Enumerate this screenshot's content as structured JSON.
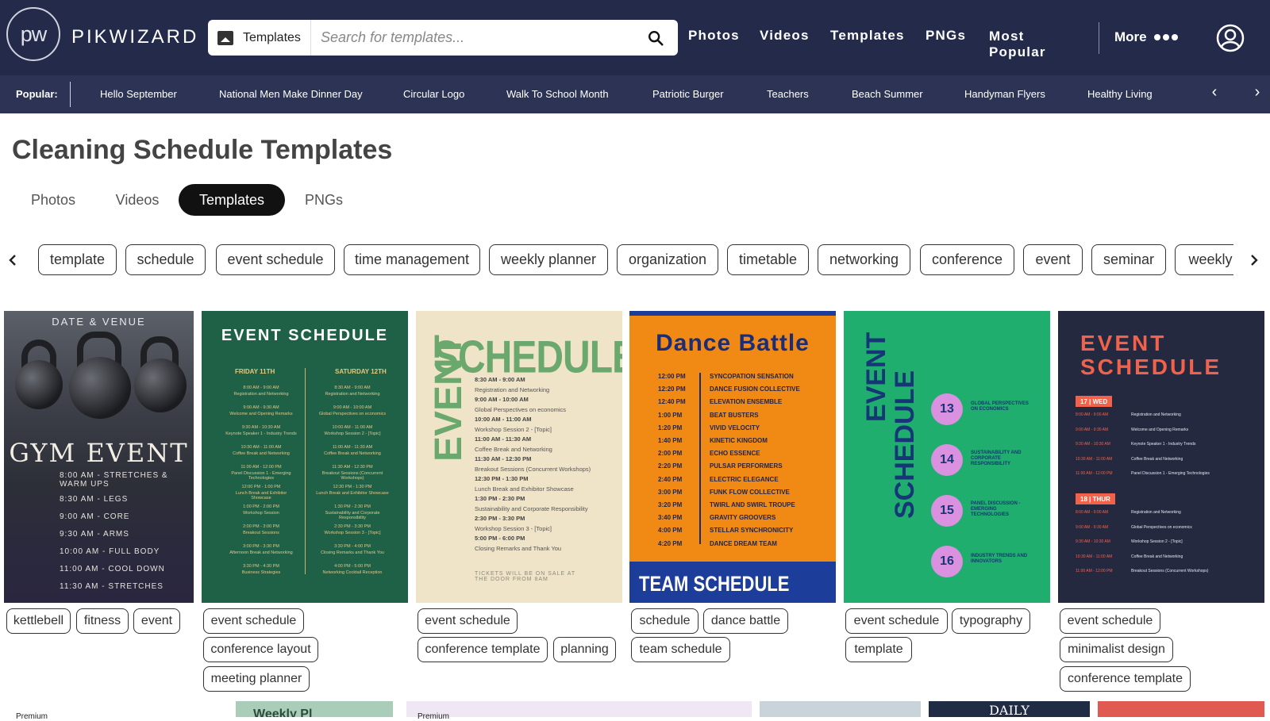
{
  "header": {
    "logo_mark": "pw",
    "logo_text": "PIKWIZARD",
    "search_type": "Templates",
    "search_placeholder": "Search for templates...",
    "nav": [
      "Photos",
      "Videos",
      "Templates",
      "PNGs",
      "Most",
      "Popular"
    ],
    "more": "More",
    "bg_color": "#232a4a"
  },
  "popular": {
    "label": "Popular:",
    "items": [
      "Hello September",
      "National Men Make Dinner Day",
      "Circular Logo",
      "Walk To School Month",
      "Patriotic Burger",
      "Teachers",
      "Beach Summer",
      "Handyman Flyers",
      "Healthy Living"
    ],
    "prev_icon": "‹",
    "next_icon": "›"
  },
  "page": {
    "title": "Cleaning Schedule Templates",
    "tabs": [
      "Photos",
      "Videos",
      "Templates",
      "PNGs"
    ],
    "active_tab": "Templates"
  },
  "chips": [
    "template",
    "schedule",
    "event schedule",
    "time management",
    "weekly planner",
    "organization",
    "timetable",
    "networking",
    "conference",
    "event",
    "seminar",
    "weekly"
  ],
  "cards": [
    {
      "venue": "DATE & VENUE",
      "title": "GYM EVENT",
      "lines": [
        "8:00 AM - STRETCHES &",
        "WARM UPS",
        "8:30 AM - LEGS",
        "9:00 AM - CORE",
        "9:30 AM - ARMS",
        "10:00 AM - FULL BODY",
        "11:00 AM - COOL DOWN",
        "11:30 AM - STRETCHES"
      ],
      "tags": [
        "kettlebell",
        "fitness",
        "event"
      ]
    },
    {
      "title": "EVENT SCHEDULE",
      "col1": "FRIDAY 11TH",
      "col2": "SATURDAY 12TH",
      "entries_left": [
        "8:00 AM - 9:00 AM",
        "Registration and Networking",
        "9:00 AM - 9:30 AM",
        "Welcome and Opening Remarks",
        "9:30 AM - 10:30 AM",
        "Keynote Speaker 1 - Industry Trends",
        "10:30 AM - 11:00 AM",
        "Coffee Break and Networking",
        "11:00 AM - 12:00 PM",
        "Panel Discussion 1 - Emerging Technologies",
        "12:00 PM - 1:00 PM",
        "Lunch Break and Exhibitor Showcase",
        "1:00 PM - 2:00 PM",
        "Workshop Session",
        "2:00 PM - 3:00 PM",
        "Breakout Sessions",
        "3:00 PM - 3:30 PM",
        "Afternoon Break and Networking",
        "3:30 PM - 4:30 PM",
        "Business Strategies"
      ],
      "entries_right": [
        "8:30 AM - 9:00 AM",
        "Registration and Networking",
        "9:00 AM - 10:00 AM",
        "Global Perspectives on economics",
        "10:00 AM - 11:00 AM",
        "Workshop Session 2 - [Topic]",
        "11:00 AM - 11:30 AM",
        "Coffee Break and Networking",
        "11:30 AM - 12:30 PM",
        "Breakout Sessions (Concurrent Workshops)",
        "12:30 PM - 1:30 PM",
        "Lunch Break and Exhibitor Showcase",
        "1:30 PM - 2:30 PM",
        "Sustainability and Corporate Responsibility",
        "2:30 PM - 3:30 PM",
        "Workshop Session 3 - [Topic]",
        "3:30 PM - 4:00 PM",
        "Closing Remarks and Thank You",
        "4:00 PM - 5:00 PM",
        "Networking Cocktail Reception"
      ],
      "tags": [
        "event schedule",
        "conference layout",
        "meeting planner"
      ]
    },
    {
      "big": "SCHEDULE",
      "vertical": "EVENT",
      "lines": [
        "8:30 AM - 9:00 AM",
        "Registration and Networking",
        "9:00 AM - 10:00 AM",
        "Global Perspectives on economics",
        "10:00 AM - 11:00 AM",
        "Workshop Session 2 - [Topic]",
        "11:00 AM - 11:30 AM",
        "Coffee Break and Networking",
        "11:30 AM - 12:30 PM",
        "Breakout Sessions (Concurrent Workshops)",
        "12:30 PM - 1:30 PM",
        "Lunch Break and Exhibitor Showcase",
        "1:30 PM - 2:30 PM",
        "Sustainability and Corporate Responsibility",
        "2:30 PM - 3:30 PM",
        "Workshop Session 3 - [Topic]",
        "5:00 PM - 6:00 PM",
        "Closing Remarks and Thank You"
      ],
      "tickets": "TICKETS WILL BE ON SALE AT THE DOOR FROM 8AM",
      "tags": [
        "event schedule",
        "conference template",
        "planning"
      ]
    },
    {
      "title": "Dance Battle",
      "times": [
        "12:00 PM",
        "12:20 PM",
        "12:40 PM",
        "1:00 PM",
        "1:20 PM",
        "1:40 PM",
        "2:00 PM",
        "2:20 PM",
        "2:40 PM",
        "3:00 PM",
        "3:20 PM",
        "3:40 PM",
        "4:00 PM",
        "4:20 PM"
      ],
      "names": [
        "SYNCOPATION SENSATION",
        "DANCE FUSION COLLECTIVE",
        "ELEVATION ENSEMBLE",
        "BEAT BUSTERS",
        "VIVID VELOCITY",
        "KINETIC KINGDOM",
        "ECHO ESSENCE",
        "PULSAR PERFORMERS",
        "ELECTRIC ELEGANCE",
        "FUNK FLOW COLLECTIVE",
        "TWIRL AND SWIRL TROUPE",
        "GRAVITY GROOVERS",
        "STELLAR SYNCHRONICITY",
        "DANCE DREAM TEAM"
      ],
      "footer": "TEAM SCHEDULE",
      "tags": [
        "schedule",
        "dance battle",
        "team schedule"
      ]
    },
    {
      "v1": "EVENT",
      "v2": "SCHEDULE",
      "items": [
        {
          "num": "13",
          "text": "GLOBAL PERSPECTIVES ON ECONOMICS"
        },
        {
          "num": "14",
          "text": "SUSTAINABILITY AND CORPORATE RESPONSIBILITY"
        },
        {
          "num": "15",
          "text": "PANEL DISCUSSION - EMERGING TECHNOLOGIES"
        },
        {
          "num": "16",
          "text": "INDUSTRY TRENDS AND INNOVATORS"
        }
      ],
      "tags": [
        "event schedule",
        "typography",
        "template"
      ]
    },
    {
      "title1": "EVENT",
      "title2": "SCHEDULE",
      "day1": "17 | WED",
      "day2": "18 | THUR",
      "rows1": [
        [
          "8:00 AM - 9:00 AM",
          "Registration and Networking"
        ],
        [
          "9:00 AM - 9:30 AM",
          "Welcome and Opening Remarks"
        ],
        [
          "9:30 AM - 10:30 AM",
          "Keynote Speaker 1 - Industry Trends"
        ],
        [
          "10:30 AM - 11:00 AM",
          "Coffee Break and Networking"
        ],
        [
          "11:00 AM - 12:00 PM",
          "Panel Discussion 1 - Emerging Technologies"
        ]
      ],
      "rows2": [
        [
          "8:00 AM - 9:00 AM",
          "Registration and Networking"
        ],
        [
          "9:00 AM - 9:30 AM",
          "Global Perspectives on economics"
        ],
        [
          "9:30 AM - 10:30 AM",
          "Workshop Session 2 - [Topic]"
        ],
        [
          "10:30 AM - 11:00 AM",
          "Coffee Break and Networking"
        ],
        [
          "11:00 AM - 12:00 PM",
          "Breakout Sessions (Concurrent Workshops)"
        ]
      ],
      "tags": [
        "event schedule",
        "minimalist design",
        "conference template"
      ]
    }
  ],
  "bottom": {
    "premium_labels": [
      "Premium",
      "Premium"
    ],
    "snippets": [
      "Weekly Pl",
      "DAILY"
    ]
  }
}
